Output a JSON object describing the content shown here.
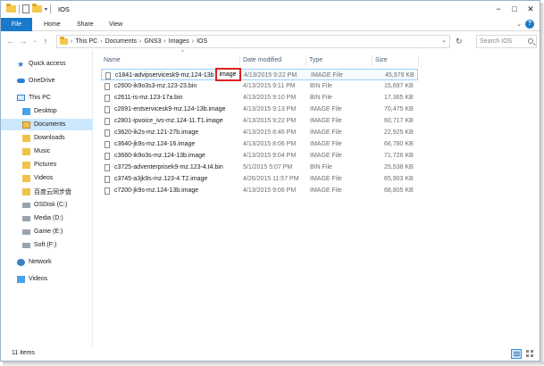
{
  "window": {
    "title": "IOS"
  },
  "ribbon": {
    "tabs": [
      {
        "label": "File"
      },
      {
        "label": "Home"
      },
      {
        "label": "Share"
      },
      {
        "label": "View"
      }
    ]
  },
  "address": {
    "crumbs": [
      "This PC",
      "Documents",
      "GNS3",
      "Images",
      "IOS"
    ],
    "search_placeholder": "Search IOS"
  },
  "sidebar": {
    "items": [
      {
        "label": "Quick access",
        "icon": "star-icon"
      },
      {
        "label": "OneDrive",
        "icon": "cloud-icon"
      },
      {
        "label": "This PC",
        "icon": "computer-icon"
      },
      {
        "label": "Desktop",
        "icon": "desktop-folder-icon"
      },
      {
        "label": "Documents",
        "icon": "documents-folder-icon",
        "selected": true
      },
      {
        "label": "Downloads",
        "icon": "downloads-folder-icon"
      },
      {
        "label": "Music",
        "icon": "music-folder-icon"
      },
      {
        "label": "Pictures",
        "icon": "pictures-folder-icon"
      },
      {
        "label": "Videos",
        "icon": "videos-folder-icon"
      },
      {
        "label": "百度云同步盘",
        "icon": "baidu-sync-folder-icon"
      },
      {
        "label": "OSDisk (C:)",
        "icon": "drive-icon"
      },
      {
        "label": "Media (D:)",
        "icon": "drive-icon"
      },
      {
        "label": "Game (E:)",
        "icon": "drive-icon"
      },
      {
        "label": "Soft (F:)",
        "icon": "drive-icon"
      },
      {
        "label": "Network",
        "icon": "network-icon"
      },
      {
        "label": "Videos",
        "icon": "videos-library-icon"
      }
    ]
  },
  "columns": {
    "name": "Name",
    "date": "Date modified",
    "type": "Type",
    "size": "Size"
  },
  "files": [
    {
      "name": "c1841-advipservicesk9-mz.124-13b",
      "rename_suffix": "image",
      "date": "4/13/2015 9:22 PM",
      "type": "IMAGE File",
      "size": "45,979 KB"
    },
    {
      "name": "c2600-ik9o3s3-mz.123-23.bin",
      "date": "4/13/2015 9:11 PM",
      "type": "BIN File",
      "size": "15,697 KB"
    },
    {
      "name": "c2611-is-mz.123-17a.bin",
      "date": "4/13/2015 9:10 PM",
      "type": "BIN File",
      "size": "17,365 KB"
    },
    {
      "name": "c2691-entservicesk9-mz.124-13b.image",
      "date": "4/13/2015 9:13 PM",
      "type": "IMAGE File",
      "size": "70,475 KB"
    },
    {
      "name": "c2801-ipvoice_ivs-mz.124-11.T1.image",
      "date": "4/13/2015 9:22 PM",
      "type": "IMAGE File",
      "size": "60,717 KB"
    },
    {
      "name": "c3620-ik2s-mz.121-27b.image",
      "date": "4/13/2015 8:46 PM",
      "type": "IMAGE File",
      "size": "22,925 KB"
    },
    {
      "name": "c3640-jk9s-mz.124-16.image",
      "date": "4/13/2015 8:06 PM",
      "type": "IMAGE File",
      "size": "66,780 KB"
    },
    {
      "name": "c3660-ik9o3s-mz.124-13b.image",
      "date": "4/13/2015 9:04 PM",
      "type": "IMAGE File",
      "size": "71,726 KB"
    },
    {
      "name": "c3725-adventerprisek9-mz.123-4.t4.bin",
      "date": "5/1/2015 5:07 PM",
      "type": "BIN File",
      "size": "25,538 KB"
    },
    {
      "name": "c3745-a3jk9s-mz.123-4.T2.image",
      "date": "4/26/2015 11:57 PM",
      "type": "IMAGE File",
      "size": "65,903 KB"
    },
    {
      "name": "c7200-jk9s-mz.124-13b.image",
      "date": "4/13/2015 9:06 PM",
      "type": "IMAGE File",
      "size": "68,805 KB"
    }
  ],
  "status": {
    "count": "11 items"
  },
  "colors": {
    "accent": "#1979ca",
    "selection": "#cce8ff",
    "rename_highlight": "#e02020"
  }
}
